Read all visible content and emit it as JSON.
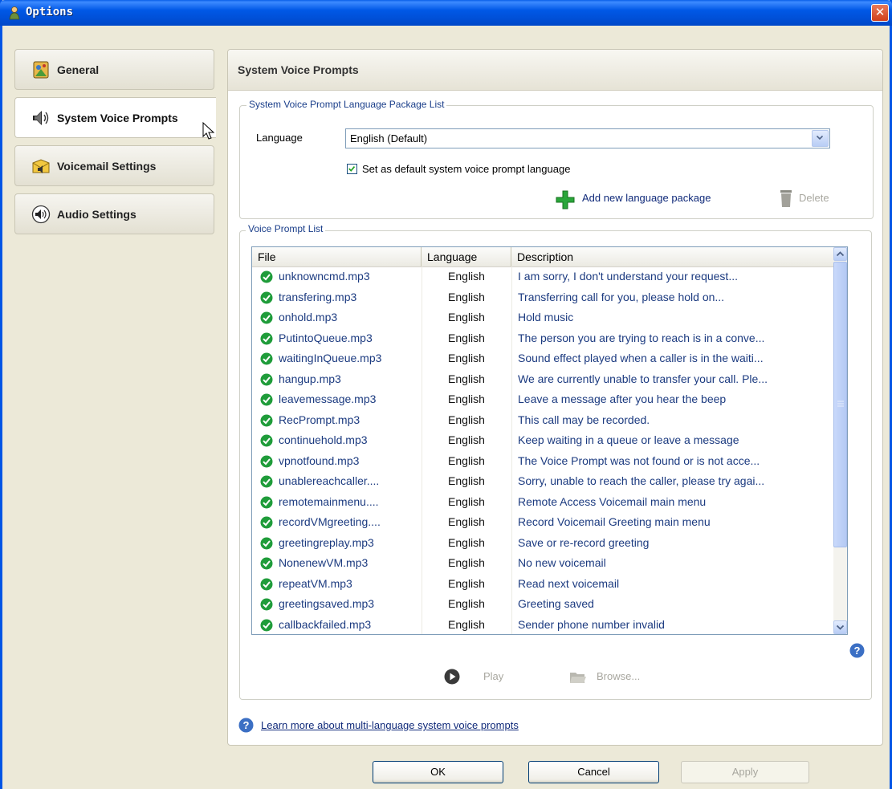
{
  "window": {
    "title": "Options"
  },
  "sidebar": {
    "items": [
      {
        "label": "General",
        "icon": "general-icon",
        "active": false
      },
      {
        "label": "System Voice Prompts",
        "icon": "speaker-icon",
        "active": true
      },
      {
        "label": "Voicemail Settings",
        "icon": "voicemail-icon",
        "active": false
      },
      {
        "label": "Audio Settings",
        "icon": "audio-icon",
        "active": false
      }
    ]
  },
  "content": {
    "title": "System Voice Prompts",
    "language_group": {
      "legend": "System Voice Prompt Language Package List",
      "language_label": "Language",
      "language_value": "English (Default)",
      "default_checkbox_label": "Set as default system voice prompt language",
      "default_checked": true,
      "add_link": "Add new language package",
      "delete_label": "Delete"
    },
    "prompt_group": {
      "legend": "Voice Prompt List",
      "columns": [
        "File",
        "Language",
        "Description"
      ],
      "rows": [
        {
          "file": "unknowncmd.mp3",
          "language": "English",
          "description": "I am sorry, I don't understand your request..."
        },
        {
          "file": "transfering.mp3",
          "language": "English",
          "description": "Transferring call for you, please hold on..."
        },
        {
          "file": "onhold.mp3",
          "language": "English",
          "description": "Hold music"
        },
        {
          "file": "PutintoQueue.mp3",
          "language": "English",
          "description": "The person you are trying to reach is in a conve..."
        },
        {
          "file": "waitingInQueue.mp3",
          "language": "English",
          "description": "Sound effect played when a caller is in the waiti..."
        },
        {
          "file": "hangup.mp3",
          "language": "English",
          "description": "We are currently unable to transfer your call. Ple..."
        },
        {
          "file": "leavemessage.mp3",
          "language": "English",
          "description": "Leave a message after you hear the beep"
        },
        {
          "file": "RecPrompt.mp3",
          "language": "English",
          "description": "This call may be recorded."
        },
        {
          "file": "continuehold.mp3",
          "language": "English",
          "description": "Keep waiting in a queue or leave a message"
        },
        {
          "file": "vpnotfound.mp3",
          "language": "English",
          "description": "The Voice Prompt was not found or is not acce..."
        },
        {
          "file": "unablereachcaller....",
          "language": "English",
          "description": "Sorry, unable to reach the caller, please try agai..."
        },
        {
          "file": "remotemainmenu....",
          "language": "English",
          "description": "Remote Access Voicemail main menu"
        },
        {
          "file": "recordVMgreeting....",
          "language": "English",
          "description": "Record Voicemail Greeting main menu"
        },
        {
          "file": "greetingreplay.mp3",
          "language": "English",
          "description": "Save or re-record greeting"
        },
        {
          "file": "NonenewVM.mp3",
          "language": "English",
          "description": "No new voicemail"
        },
        {
          "file": "repeatVM.mp3",
          "language": "English",
          "description": "Read next voicemail"
        },
        {
          "file": "greetingsaved.mp3",
          "language": "English",
          "description": "Greeting saved"
        },
        {
          "file": "callbackfailed.mp3",
          "language": "English",
          "description": "Sender phone number invalid"
        }
      ],
      "play_label": "Play",
      "browse_label": "Browse..."
    },
    "learn_more_link": "Learn more about multi-language system voice prompts"
  },
  "footer": {
    "ok_label": "OK",
    "cancel_label": "Cancel",
    "apply_label": "Apply"
  },
  "colors": {
    "title_bar": "#0058e6",
    "link": "#102a7a",
    "success_green": "#1f9c3a",
    "add_green": "#2aa63a"
  }
}
